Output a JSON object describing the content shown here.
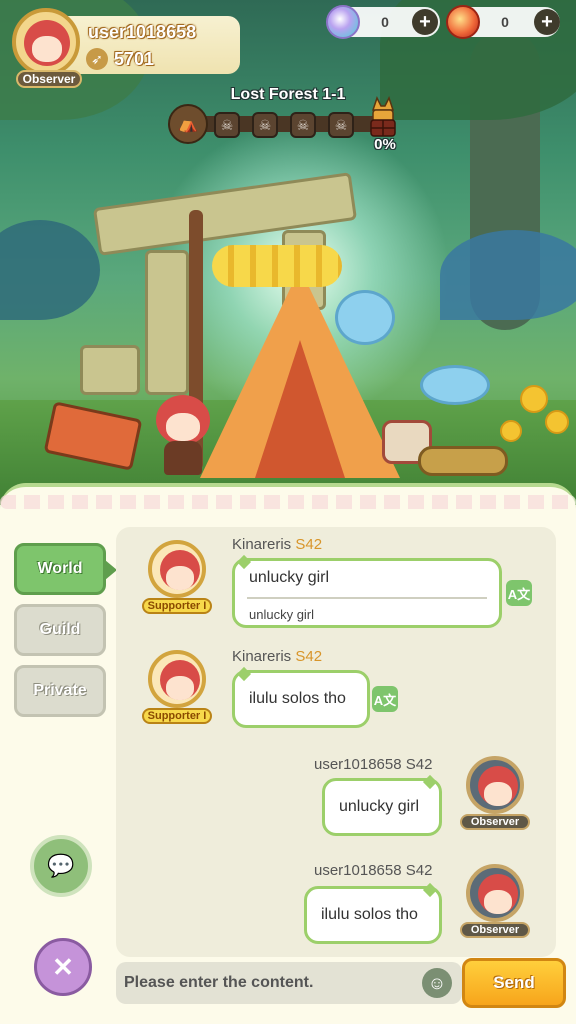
{
  "profile": {
    "username": "user1018658",
    "power": "5701",
    "badge": "Observer"
  },
  "currencies": [
    {
      "icon": "crystal-icon",
      "value": "0"
    },
    {
      "icon": "gem-icon",
      "value": "0"
    }
  ],
  "stage": {
    "title": "Lost Forest 1-1",
    "progress": "0%",
    "progress_fraction": 0
  },
  "chat": {
    "tabs": [
      {
        "label": "World",
        "active": true
      },
      {
        "label": "Guild",
        "active": false
      },
      {
        "label": "Private",
        "active": false
      }
    ],
    "messages": [
      {
        "sender": "Kinareris",
        "server": "S42",
        "badge": "Supporter I",
        "text": "unlucky girl",
        "translation": "unlucky girl",
        "mine": false
      },
      {
        "sender": "Kinareris",
        "server": "S42",
        "badge": "Supporter I",
        "text": "ilulu solos tho",
        "mine": false
      },
      {
        "sender": "user1018658",
        "server": "S42",
        "badge": "Observer",
        "text": "unlucky girl",
        "mine": true
      },
      {
        "sender": "user1018658",
        "server": "S42",
        "badge": "Observer",
        "text": "ilulu solos tho",
        "mine": true
      }
    ],
    "input_placeholder": "Please enter the content.",
    "send_label": "Send"
  },
  "colors": {
    "accent_green": "#7ec56c",
    "send_orange": "#f7a51b",
    "server_tag": "#d8952a"
  }
}
